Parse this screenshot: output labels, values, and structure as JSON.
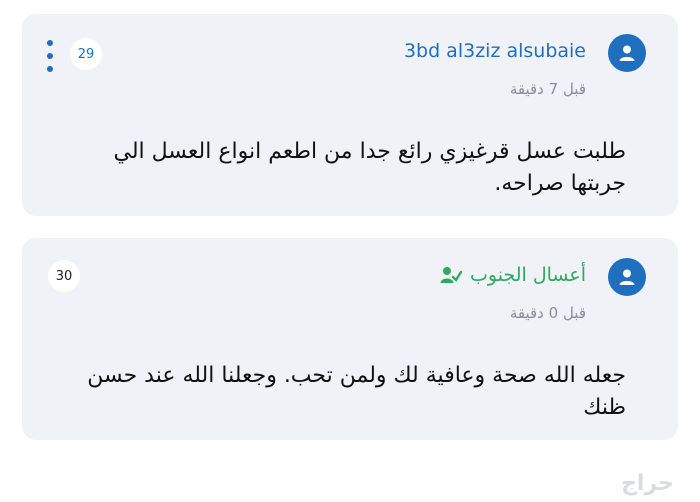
{
  "comments": [
    {
      "author": "3bd al3ziz alsubaie",
      "time": "قبل 7 دقيقة",
      "text": "طلبت عسل قرغيزي رائع جدا من اطعم انواع العسل الي جربتها صراحه.",
      "number": "29",
      "author_color": "#1f6fbf"
    },
    {
      "author": "أعسال الجنوب",
      "time": "قبل 0 دقيقة",
      "text": "جعله الله صحة وعافية لك ولمن تحب. وجعلنا الله عند حسن ظنك",
      "number": "30",
      "author_color": "#2eaa5e",
      "author_icon": "verified-seller-icon"
    }
  ],
  "watermark": "حراج"
}
